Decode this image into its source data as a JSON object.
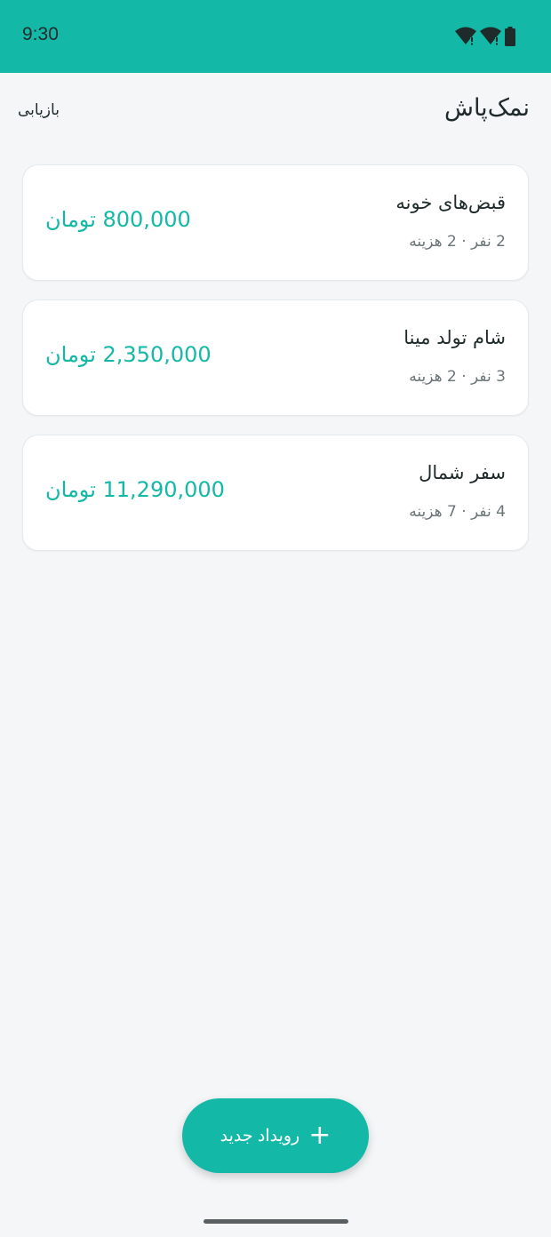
{
  "status_bar": {
    "time": "9:30",
    "icons": [
      "wifi-icon",
      "wifi-icon",
      "battery-icon"
    ]
  },
  "app_bar": {
    "title": "نمک‌پاش",
    "restore_label": "بازیابی"
  },
  "events": [
    {
      "title": "قبض‌های خونه",
      "meta": "2 نفر · 2 هزینه",
      "amount": "800,000 تومان"
    },
    {
      "title": "شام تولد مینا",
      "meta": "3 نفر · 2 هزینه",
      "amount": "2,350,000 تومان"
    },
    {
      "title": "سفر شمال",
      "meta": "4 نفر · 7 هزینه",
      "amount": "11,290,000 تومان"
    }
  ],
  "fab": {
    "icon": "plus-icon",
    "label": "رویداد جدید"
  },
  "colors": {
    "accent": "#14b8a6",
    "background": "#f4f6f8",
    "card": "#ffffff",
    "text_primary": "#1f2a2a",
    "text_secondary": "#6b7578"
  }
}
